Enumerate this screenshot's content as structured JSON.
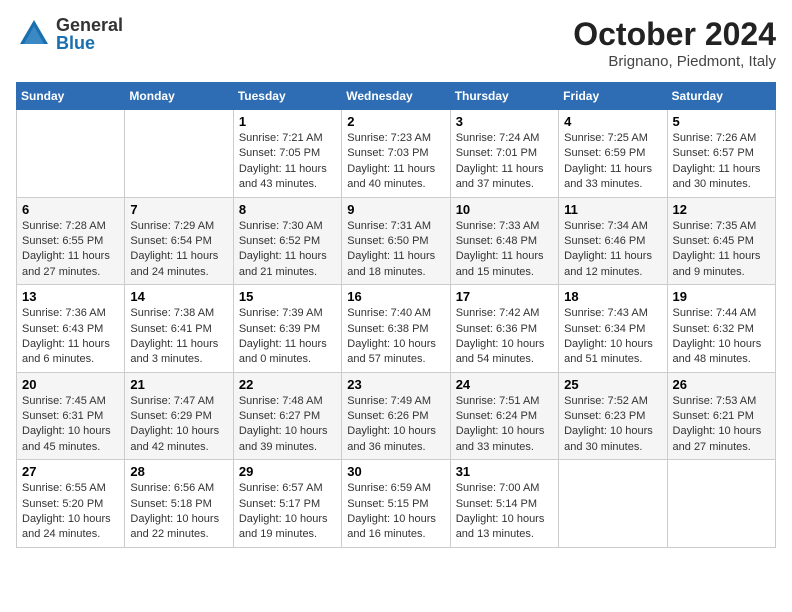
{
  "logo": {
    "general": "General",
    "blue": "Blue"
  },
  "title": "October 2024",
  "location": "Brignano, Piedmont, Italy",
  "weekdays": [
    "Sunday",
    "Monday",
    "Tuesday",
    "Wednesday",
    "Thursday",
    "Friday",
    "Saturday"
  ],
  "weeks": [
    [
      {
        "day": "",
        "sunrise": "",
        "sunset": "",
        "daylight": ""
      },
      {
        "day": "",
        "sunrise": "",
        "sunset": "",
        "daylight": ""
      },
      {
        "day": "1",
        "sunrise": "Sunrise: 7:21 AM",
        "sunset": "Sunset: 7:05 PM",
        "daylight": "Daylight: 11 hours and 43 minutes."
      },
      {
        "day": "2",
        "sunrise": "Sunrise: 7:23 AM",
        "sunset": "Sunset: 7:03 PM",
        "daylight": "Daylight: 11 hours and 40 minutes."
      },
      {
        "day": "3",
        "sunrise": "Sunrise: 7:24 AM",
        "sunset": "Sunset: 7:01 PM",
        "daylight": "Daylight: 11 hours and 37 minutes."
      },
      {
        "day": "4",
        "sunrise": "Sunrise: 7:25 AM",
        "sunset": "Sunset: 6:59 PM",
        "daylight": "Daylight: 11 hours and 33 minutes."
      },
      {
        "day": "5",
        "sunrise": "Sunrise: 7:26 AM",
        "sunset": "Sunset: 6:57 PM",
        "daylight": "Daylight: 11 hours and 30 minutes."
      }
    ],
    [
      {
        "day": "6",
        "sunrise": "Sunrise: 7:28 AM",
        "sunset": "Sunset: 6:55 PM",
        "daylight": "Daylight: 11 hours and 27 minutes."
      },
      {
        "day": "7",
        "sunrise": "Sunrise: 7:29 AM",
        "sunset": "Sunset: 6:54 PM",
        "daylight": "Daylight: 11 hours and 24 minutes."
      },
      {
        "day": "8",
        "sunrise": "Sunrise: 7:30 AM",
        "sunset": "Sunset: 6:52 PM",
        "daylight": "Daylight: 11 hours and 21 minutes."
      },
      {
        "day": "9",
        "sunrise": "Sunrise: 7:31 AM",
        "sunset": "Sunset: 6:50 PM",
        "daylight": "Daylight: 11 hours and 18 minutes."
      },
      {
        "day": "10",
        "sunrise": "Sunrise: 7:33 AM",
        "sunset": "Sunset: 6:48 PM",
        "daylight": "Daylight: 11 hours and 15 minutes."
      },
      {
        "day": "11",
        "sunrise": "Sunrise: 7:34 AM",
        "sunset": "Sunset: 6:46 PM",
        "daylight": "Daylight: 11 hours and 12 minutes."
      },
      {
        "day": "12",
        "sunrise": "Sunrise: 7:35 AM",
        "sunset": "Sunset: 6:45 PM",
        "daylight": "Daylight: 11 hours and 9 minutes."
      }
    ],
    [
      {
        "day": "13",
        "sunrise": "Sunrise: 7:36 AM",
        "sunset": "Sunset: 6:43 PM",
        "daylight": "Daylight: 11 hours and 6 minutes."
      },
      {
        "day": "14",
        "sunrise": "Sunrise: 7:38 AM",
        "sunset": "Sunset: 6:41 PM",
        "daylight": "Daylight: 11 hours and 3 minutes."
      },
      {
        "day": "15",
        "sunrise": "Sunrise: 7:39 AM",
        "sunset": "Sunset: 6:39 PM",
        "daylight": "Daylight: 11 hours and 0 minutes."
      },
      {
        "day": "16",
        "sunrise": "Sunrise: 7:40 AM",
        "sunset": "Sunset: 6:38 PM",
        "daylight": "Daylight: 10 hours and 57 minutes."
      },
      {
        "day": "17",
        "sunrise": "Sunrise: 7:42 AM",
        "sunset": "Sunset: 6:36 PM",
        "daylight": "Daylight: 10 hours and 54 minutes."
      },
      {
        "day": "18",
        "sunrise": "Sunrise: 7:43 AM",
        "sunset": "Sunset: 6:34 PM",
        "daylight": "Daylight: 10 hours and 51 minutes."
      },
      {
        "day": "19",
        "sunrise": "Sunrise: 7:44 AM",
        "sunset": "Sunset: 6:32 PM",
        "daylight": "Daylight: 10 hours and 48 minutes."
      }
    ],
    [
      {
        "day": "20",
        "sunrise": "Sunrise: 7:45 AM",
        "sunset": "Sunset: 6:31 PM",
        "daylight": "Daylight: 10 hours and 45 minutes."
      },
      {
        "day": "21",
        "sunrise": "Sunrise: 7:47 AM",
        "sunset": "Sunset: 6:29 PM",
        "daylight": "Daylight: 10 hours and 42 minutes."
      },
      {
        "day": "22",
        "sunrise": "Sunrise: 7:48 AM",
        "sunset": "Sunset: 6:27 PM",
        "daylight": "Daylight: 10 hours and 39 minutes."
      },
      {
        "day": "23",
        "sunrise": "Sunrise: 7:49 AM",
        "sunset": "Sunset: 6:26 PM",
        "daylight": "Daylight: 10 hours and 36 minutes."
      },
      {
        "day": "24",
        "sunrise": "Sunrise: 7:51 AM",
        "sunset": "Sunset: 6:24 PM",
        "daylight": "Daylight: 10 hours and 33 minutes."
      },
      {
        "day": "25",
        "sunrise": "Sunrise: 7:52 AM",
        "sunset": "Sunset: 6:23 PM",
        "daylight": "Daylight: 10 hours and 30 minutes."
      },
      {
        "day": "26",
        "sunrise": "Sunrise: 7:53 AM",
        "sunset": "Sunset: 6:21 PM",
        "daylight": "Daylight: 10 hours and 27 minutes."
      }
    ],
    [
      {
        "day": "27",
        "sunrise": "Sunrise: 6:55 AM",
        "sunset": "Sunset: 5:20 PM",
        "daylight": "Daylight: 10 hours and 24 minutes."
      },
      {
        "day": "28",
        "sunrise": "Sunrise: 6:56 AM",
        "sunset": "Sunset: 5:18 PM",
        "daylight": "Daylight: 10 hours and 22 minutes."
      },
      {
        "day": "29",
        "sunrise": "Sunrise: 6:57 AM",
        "sunset": "Sunset: 5:17 PM",
        "daylight": "Daylight: 10 hours and 19 minutes."
      },
      {
        "day": "30",
        "sunrise": "Sunrise: 6:59 AM",
        "sunset": "Sunset: 5:15 PM",
        "daylight": "Daylight: 10 hours and 16 minutes."
      },
      {
        "day": "31",
        "sunrise": "Sunrise: 7:00 AM",
        "sunset": "Sunset: 5:14 PM",
        "daylight": "Daylight: 10 hours and 13 minutes."
      },
      {
        "day": "",
        "sunrise": "",
        "sunset": "",
        "daylight": ""
      },
      {
        "day": "",
        "sunrise": "",
        "sunset": "",
        "daylight": ""
      }
    ]
  ]
}
